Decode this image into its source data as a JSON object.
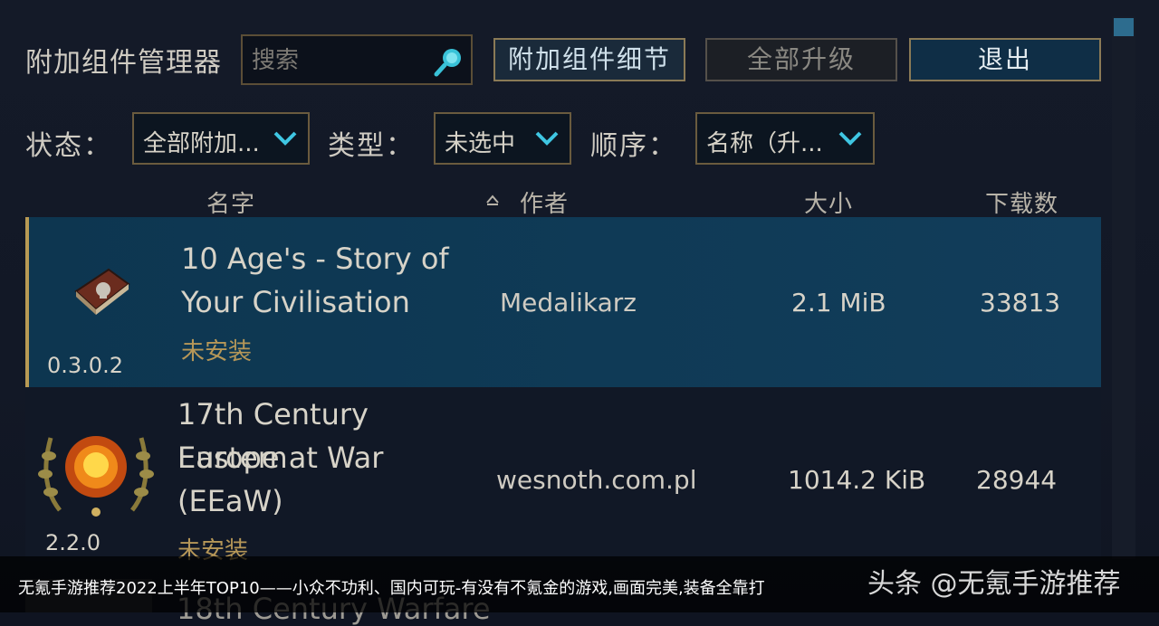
{
  "header": {
    "title": "附加组件管理器",
    "search_placeholder": "搜索",
    "details_button": "附加组件细节",
    "upgrade_all_button": "全部升级",
    "quit_button": "退出"
  },
  "filters": {
    "status_label": "状态：",
    "status_value": "全部附加...",
    "type_label": "类型：",
    "type_value": "未选中",
    "order_label": "顺序：",
    "order_value": "名称（升..."
  },
  "columns": {
    "name": "名字",
    "author": "作者",
    "size": "大小",
    "downloads": "下载数"
  },
  "rows": [
    {
      "name_line1": "10 Age's - Story of",
      "name_line2": "Your Civilisation",
      "status": "未安装",
      "version": "0.3.0.2",
      "author": "Medalikarz",
      "size": "2.1 MiB",
      "downloads": "33813",
      "icon": "book-icon"
    },
    {
      "name_line1": "17th Century Eastern",
      "name_line2": "Europe at War (EEaW)",
      "status": "未安装",
      "version": "2.2.0",
      "author": "wesnoth.com.pl",
      "size": "1014.2 KiB",
      "downloads": "28944",
      "icon": "laurel-explosion-icon"
    },
    {
      "name_line1": "18th Century Warfare"
    }
  ],
  "overlay": {
    "caption": "无氪手游推荐2022上半年TOP10——小众不功利、国内可玩-有没有不氪金的游戏,画面完美,装备全靠打",
    "brand": "头条 @无氪手游推荐"
  }
}
